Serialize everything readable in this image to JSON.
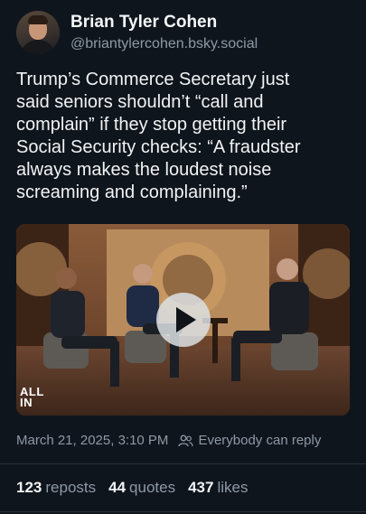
{
  "author": {
    "display_name": "Brian Tyler Cohen",
    "handle": "@briantylercohen.bsky.social"
  },
  "post": {
    "text": "Trump’s Commerce Secretary just\nsaid seniors shouldn’t “call and\ncomplain” if they stop getting their\nSocial Security checks: “A fraudster\nalways makes the loudest noise\nscreaming and complaining.”",
    "video_watermark": "ALL\nIN",
    "timestamp": "March 21, 2025, 3:10 PM",
    "reply_setting": "Everybody can reply"
  },
  "stats": {
    "reposts_count": "123",
    "reposts_label": "reposts",
    "quotes_count": "44",
    "quotes_label": "quotes",
    "likes_count": "437",
    "likes_label": "likes"
  },
  "icons": {
    "play": "play-icon",
    "people": "people-icon"
  },
  "colors": {
    "background": "#0f151c",
    "muted_text": "#8d99a6"
  }
}
